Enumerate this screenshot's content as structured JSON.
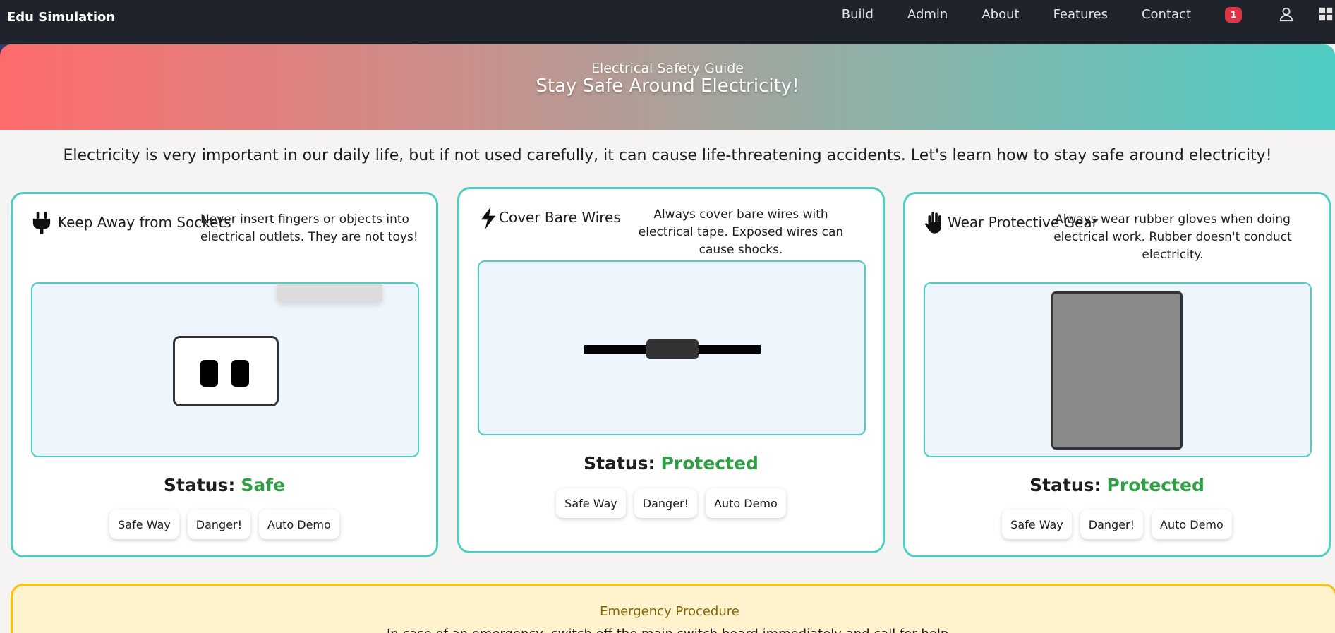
{
  "nav": {
    "brand": "Edu Simulation",
    "links": [
      "Build",
      "Admin",
      "About",
      "Features",
      "Contact"
    ],
    "notification_count": "1",
    "icons": [
      "user-icon",
      "grid-icon"
    ]
  },
  "hero": {
    "subtitle": "Electrical Safety Guide",
    "title": "Stay Safe Around Electricity!",
    "colors": {
      "start": "#ff6b6b",
      "end": "#4ecdc4"
    }
  },
  "intro": "Electricity is very important in our daily life, but if not used carefully, it can cause life-threatening accidents. Let's learn how to stay safe around electricity!",
  "cards": [
    {
      "icon": "plug-icon",
      "title": "Keep Away from Sockets",
      "description": "Never insert fingers or objects into electrical outlets. They are not toys!",
      "status_label": "Status:",
      "status_value": "Safe",
      "buttons": [
        "Safe Way",
        "Danger!",
        "Auto Demo"
      ]
    },
    {
      "icon": "bolt-icon",
      "title": "Cover Bare Wires",
      "description": "Always cover bare wires with electrical tape. Exposed wires can cause shocks.",
      "status_label": "Status:",
      "status_value": "Protected",
      "buttons": [
        "Safe Way",
        "Danger!",
        "Auto Demo"
      ]
    },
    {
      "icon": "hand-icon",
      "title": "Wear Protective Gear",
      "description": "Always wear rubber gloves when doing electrical work. Rubber doesn't conduct electricity.",
      "status_label": "Status:",
      "status_value": "Protected",
      "buttons": [
        "Safe Way",
        "Danger!",
        "Auto Demo"
      ]
    }
  ],
  "emergency": {
    "title": "Emergency Procedure",
    "text": "In case of an emergency, switch off the main switch board immediately and call for help."
  },
  "colors": {
    "accent": "#4ecdc4",
    "status_ok": "#2f9e44",
    "badge": "#dc3545",
    "warning_border": "#ffc107"
  }
}
